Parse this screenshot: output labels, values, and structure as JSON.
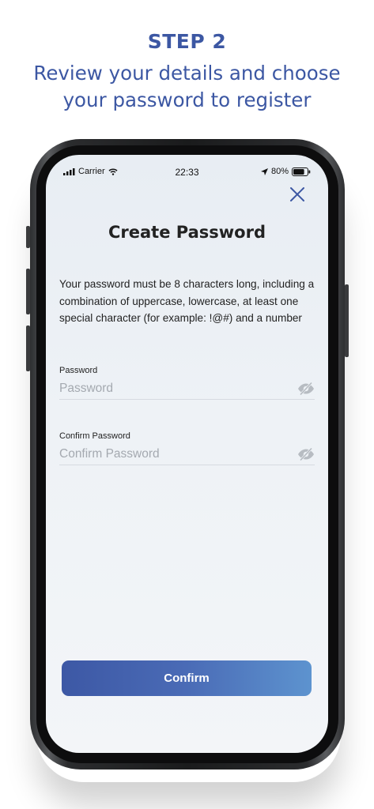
{
  "header": {
    "step": "STEP 2",
    "subtitle_line1": "Review your details and choose",
    "subtitle_line2": "your password to register"
  },
  "status_bar": {
    "carrier": "Carrier",
    "time": "22:33",
    "battery": "80%",
    "battery_level": 0.8
  },
  "screen": {
    "title": "Create Password",
    "instructions": "Your password must be 8 characters long, including a combination of uppercase, lowercase, at least one special character (for example: !@#) and a number",
    "password": {
      "label": "Password",
      "placeholder": "Password",
      "value": ""
    },
    "confirm_password": {
      "label": "Confirm Password",
      "placeholder": "Confirm Password",
      "value": ""
    },
    "confirm_label": "Confirm"
  },
  "icons": [
    "close-icon",
    "eye-slash-icon",
    "signal-icon",
    "wifi-icon",
    "location-arrow-icon",
    "battery-icon"
  ],
  "colors": {
    "brand": "#3c57a3",
    "button_start": "#3d58a5",
    "button_end": "#5d93cf"
  }
}
